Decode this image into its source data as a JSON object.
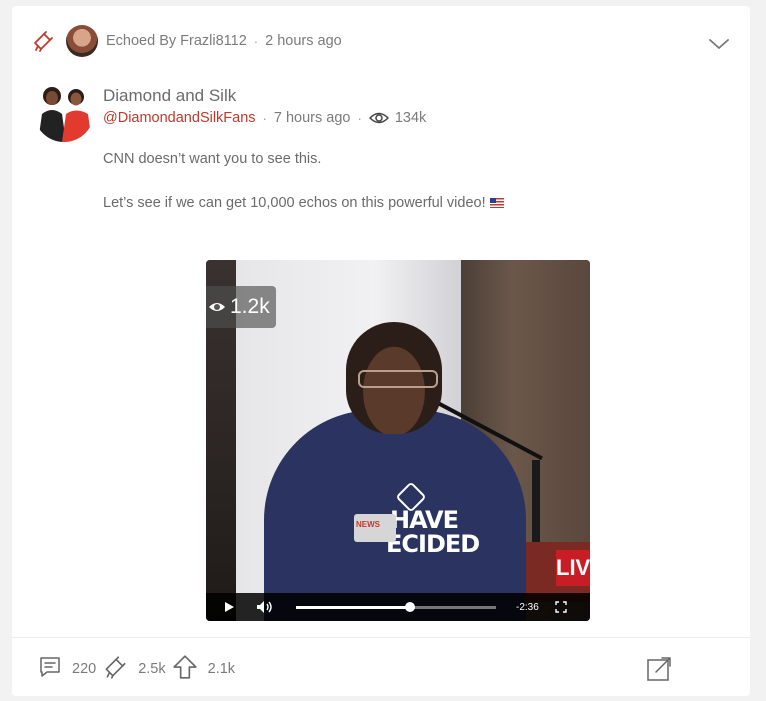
{
  "echo": {
    "label": "Echoed By Frazli8112",
    "time": "2 hours ago",
    "icon": "echo-icon",
    "accent": "#c0392b"
  },
  "author": {
    "name": "Diamond and Silk",
    "handle": "@DiamondandSilkFans",
    "time": "7 hours ago",
    "views": "134k"
  },
  "post": {
    "line1": "CNN doesn’t want you to see this.",
    "line2": "Let’s see if we can get 10,000 echos on this powerful video!"
  },
  "video": {
    "views": "1.2k",
    "shirt_line1": "HAVE",
    "shirt_line2": "ECIDED",
    "live_label": "LIV",
    "time_remaining": "-2:36",
    "progress": 0.57
  },
  "footer": {
    "comments": "220",
    "echoes": "2.5k",
    "upvotes": "2.1k"
  }
}
